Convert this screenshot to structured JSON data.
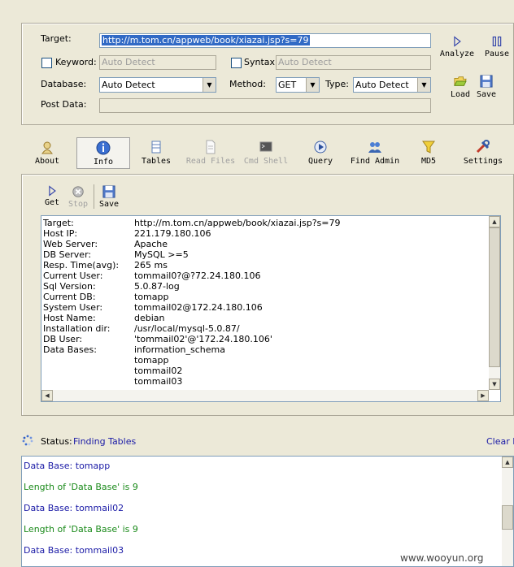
{
  "form": {
    "target_label": "Target:",
    "target_value": "http://m.tom.cn/appweb/book/xiazai.jsp?s=79",
    "keyword_label": "Keyword:",
    "keyword_placeholder": "Auto Detect",
    "syntax_label": "Syntax:",
    "syntax_placeholder": "Auto Detect",
    "database_label": "Database:",
    "database_value": "Auto Detect",
    "method_label": "Method:",
    "method_value": "GET",
    "type_label": "Type:",
    "type_value": "Auto Detect",
    "postdata_label": "Post Data:"
  },
  "side_buttons": {
    "analyze": "Analyze",
    "pause": "Pause",
    "load": "Load",
    "save": "Save"
  },
  "toolbar": [
    {
      "label": "About",
      "icon": "about-icon",
      "enabled": true
    },
    {
      "label": "Info",
      "icon": "info-icon",
      "enabled": true,
      "active": true
    },
    {
      "label": "Tables",
      "icon": "tables-icon",
      "enabled": true
    },
    {
      "label": "Read Files",
      "icon": "read-files-icon",
      "enabled": false
    },
    {
      "label": "Cmd Shell",
      "icon": "cmd-shell-icon",
      "enabled": false
    },
    {
      "label": "Query",
      "icon": "query-icon",
      "enabled": true
    },
    {
      "label": "Find Admin",
      "icon": "find-admin-icon",
      "enabled": true
    },
    {
      "label": "MD5",
      "icon": "md5-icon",
      "enabled": true
    },
    {
      "label": "Settings",
      "icon": "settings-icon",
      "enabled": true
    }
  ],
  "info_toolbar": {
    "get": "Get",
    "stop": "Stop",
    "save": "Save"
  },
  "info": [
    {
      "key": "Target:",
      "value": "http://m.tom.cn/appweb/book/xiazai.jsp?s=79"
    },
    {
      "key": "Host IP:",
      "value": "221.179.180.106"
    },
    {
      "key": "Web Server:",
      "value": "Apache"
    },
    {
      "key": "DB Server:",
      "value": "MySQL >=5"
    },
    {
      "key": "Resp. Time(avg):",
      "value": "265 ms"
    },
    {
      "key": "Current User:",
      "value": "tommail0?@?72.24.180.106"
    },
    {
      "key": "Sql Version:",
      "value": "5.0.87-log"
    },
    {
      "key": "Current DB:",
      "value": "tomapp"
    },
    {
      "key": "System User:",
      "value": "tommail02@172.24.180.106"
    },
    {
      "key": "Host Name:",
      "value": "debian"
    },
    {
      "key": "Installation dir:",
      "value": "/usr/local/mysql-5.0.87/"
    },
    {
      "key": "DB User:",
      "value": "'tommail02'@'172.24.180.106'"
    },
    {
      "key": "Data Bases:",
      "value": "information_schema"
    },
    {
      "key": "",
      "value": "tomapp"
    },
    {
      "key": "",
      "value": "tommail02"
    },
    {
      "key": "",
      "value": "tommail03"
    }
  ],
  "status": {
    "label": "Status:",
    "value": "Finding Tables",
    "clear": "Clear L"
  },
  "log": [
    {
      "text": "Data Base: tomapp",
      "color": "#1a1aa6"
    },
    {
      "text": "Length of 'Data Base' is 9",
      "color": "#1a8a1a"
    },
    {
      "text": "Data Base: tommail02",
      "color": "#1a1aa6"
    },
    {
      "text": "Length of 'Data Base' is 9",
      "color": "#1a8a1a"
    },
    {
      "text": "Data Base: tommail03",
      "color": "#1a1aa6"
    }
  ],
  "watermark": "www.wooyun.org"
}
